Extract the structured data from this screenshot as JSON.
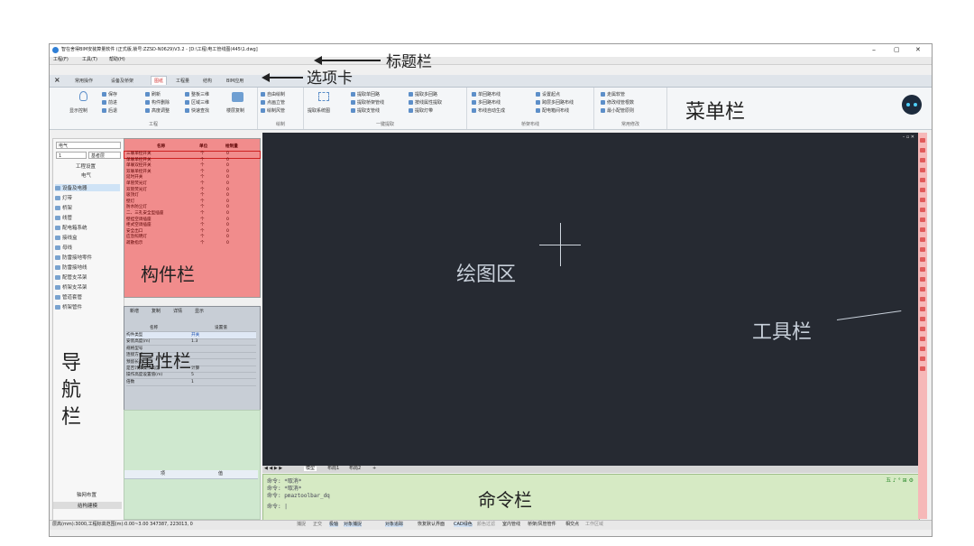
{
  "window": {
    "title": "智在舍得BIM安装算量软件 (正式版,锁号:ZZSD-N0629)V3.2 - [D:\\工程\\电工管线图(445\\1.dwg]",
    "min_glyph": "–",
    "max_glyph": "▢",
    "close_glyph": "✕"
  },
  "menubar": {
    "items": [
      "工程(F)",
      "工具(T)",
      "帮助(H)"
    ]
  },
  "tabs": {
    "close_glyph": "×",
    "items": [
      "常用操作",
      "设备及桥架",
      "图纸",
      "工程量",
      "结构",
      "BIM应用"
    ],
    "active": "图纸"
  },
  "ribbon": {
    "group1": {
      "name": "工程",
      "buttons": [
        "显示控制",
        "保存",
        "前进",
        "后退",
        "刷新",
        "构件删除",
        "高度调整",
        "整板三维",
        "区域三维",
        "快速查找",
        "楼层复制"
      ]
    },
    "group2": {
      "name": "绘制",
      "buttons": [
        "自由绘制",
        "点画立管",
        "绘制风管"
      ]
    },
    "group3": {
      "name": "一键提取",
      "buttons": [
        "提取系统图",
        "提取单回路",
        "提取桥架管线",
        "提取支管线",
        "提取多回路",
        "按线属性提取",
        "提取灯带",
        "提取线"
      ]
    },
    "group4": {
      "name": "桥架布线",
      "buttons": [
        "单回路布线",
        "多回路布线",
        "布线自动生成",
        "设置起点",
        "跨层多回路布线",
        "配电箱间布线"
      ]
    },
    "group5": {
      "name": "常用修改",
      "buttons": [
        "走属软管",
        "修改线管根数",
        "最小配管原则"
      ]
    }
  },
  "left_nav": {
    "discipline": "电气",
    "floor_no": "1",
    "floor_name": "基者层",
    "project_settings": "工程设置",
    "category": "电气",
    "items": [
      "设备及电器",
      "灯带",
      "桥架",
      "线管",
      "配电箱系统",
      "接线盒",
      "母线",
      "防雷接地零件",
      "防雷接地线",
      "配管支吊架",
      "桥架支吊架",
      "管道套管",
      "桥架管件"
    ],
    "bottom_items": [
      "轴网布置",
      "结构建模"
    ]
  },
  "component_table": {
    "headers": [
      "名称",
      "单位",
      "绘制量"
    ],
    "rows": [
      [
        "三联单控开关",
        "个",
        "0"
      ],
      [
        "单联单控开关",
        "个",
        "0"
      ],
      [
        "单联双控开关",
        "个",
        "0"
      ],
      [
        "双联单控开关",
        "个",
        "0"
      ],
      [
        "延时开关",
        "个",
        "0"
      ],
      [
        "单管荧光灯",
        "个",
        "0"
      ],
      [
        "双管荧光灯",
        "个",
        "0"
      ],
      [
        "吸顶灯",
        "个",
        "0"
      ],
      [
        "壁灯",
        "个",
        "0"
      ],
      [
        "防水防尘灯",
        "个",
        "0"
      ],
      [
        "二、三孔安全型插座",
        "个",
        "0"
      ],
      [
        "壁挂空调插座",
        "个",
        "0"
      ],
      [
        "柜式空调插座",
        "个",
        "0"
      ],
      [
        "安全出口",
        "个",
        "0"
      ],
      [
        "应急照明灯",
        "个",
        "0"
      ],
      [
        "疏散指示",
        "个",
        "0"
      ]
    ]
  },
  "properties": {
    "tabs": [
      "新增",
      "复制",
      "详情",
      "显示"
    ],
    "headers": [
      "名称",
      "设置值"
    ],
    "rows": [
      [
        "构件类型",
        "开关"
      ],
      [
        "安装高度(m)",
        "1.3"
      ],
      [
        "规格型号",
        ""
      ],
      [
        "连接方式",
        ""
      ],
      [
        "预留长度",
        ""
      ],
      [
        "是否计算操作高度",
        "计算"
      ],
      [
        "操作高度设置值(m)",
        "5"
      ],
      [
        "倍数",
        "1"
      ]
    ],
    "bottom_headers": [
      "项",
      "值"
    ]
  },
  "drawing": {
    "window_controls": "– ▫ ✕"
  },
  "sheet_tabs": {
    "nav": "◀ ◀ ▶ ▶",
    "tabs": [
      "模型",
      "布局1",
      "布局2",
      "+"
    ]
  },
  "command": {
    "lines": [
      "命令: *取消*",
      "命令: *取消*",
      "命令: pmaztoolbar_dq",
      "命令: |"
    ],
    "ime": "五 ♪ ° ⊞ ⚙"
  },
  "status_bar": {
    "left": "层高(mm):3000,工程标高范围(m):0.00~3.00   347387, 223013, 0",
    "toggles": [
      "捕捉",
      "正交",
      "极轴",
      "对象捕捉",
      "对象追踪",
      "恢复默认界面",
      "CAD绿色",
      "颜色过滤",
      "室内管线",
      "桥架/风管管件",
      "相交点",
      "工作区域"
    ]
  },
  "annotations": {
    "title_bar": "标题栏",
    "tabs": "选项卡",
    "menu": "菜单栏",
    "component": "构件栏",
    "property": "属性栏",
    "nav": "导航栏",
    "drawing": "绘图区",
    "toolbar": "工具栏",
    "command": "命令栏"
  },
  "colors": {
    "component_bg": "#f18c8c",
    "drawing_bg": "#262a32",
    "command_bg": "#d6eac4",
    "toolbar_bg": "#f6b8b8",
    "active_tab": "#d43b3b"
  }
}
